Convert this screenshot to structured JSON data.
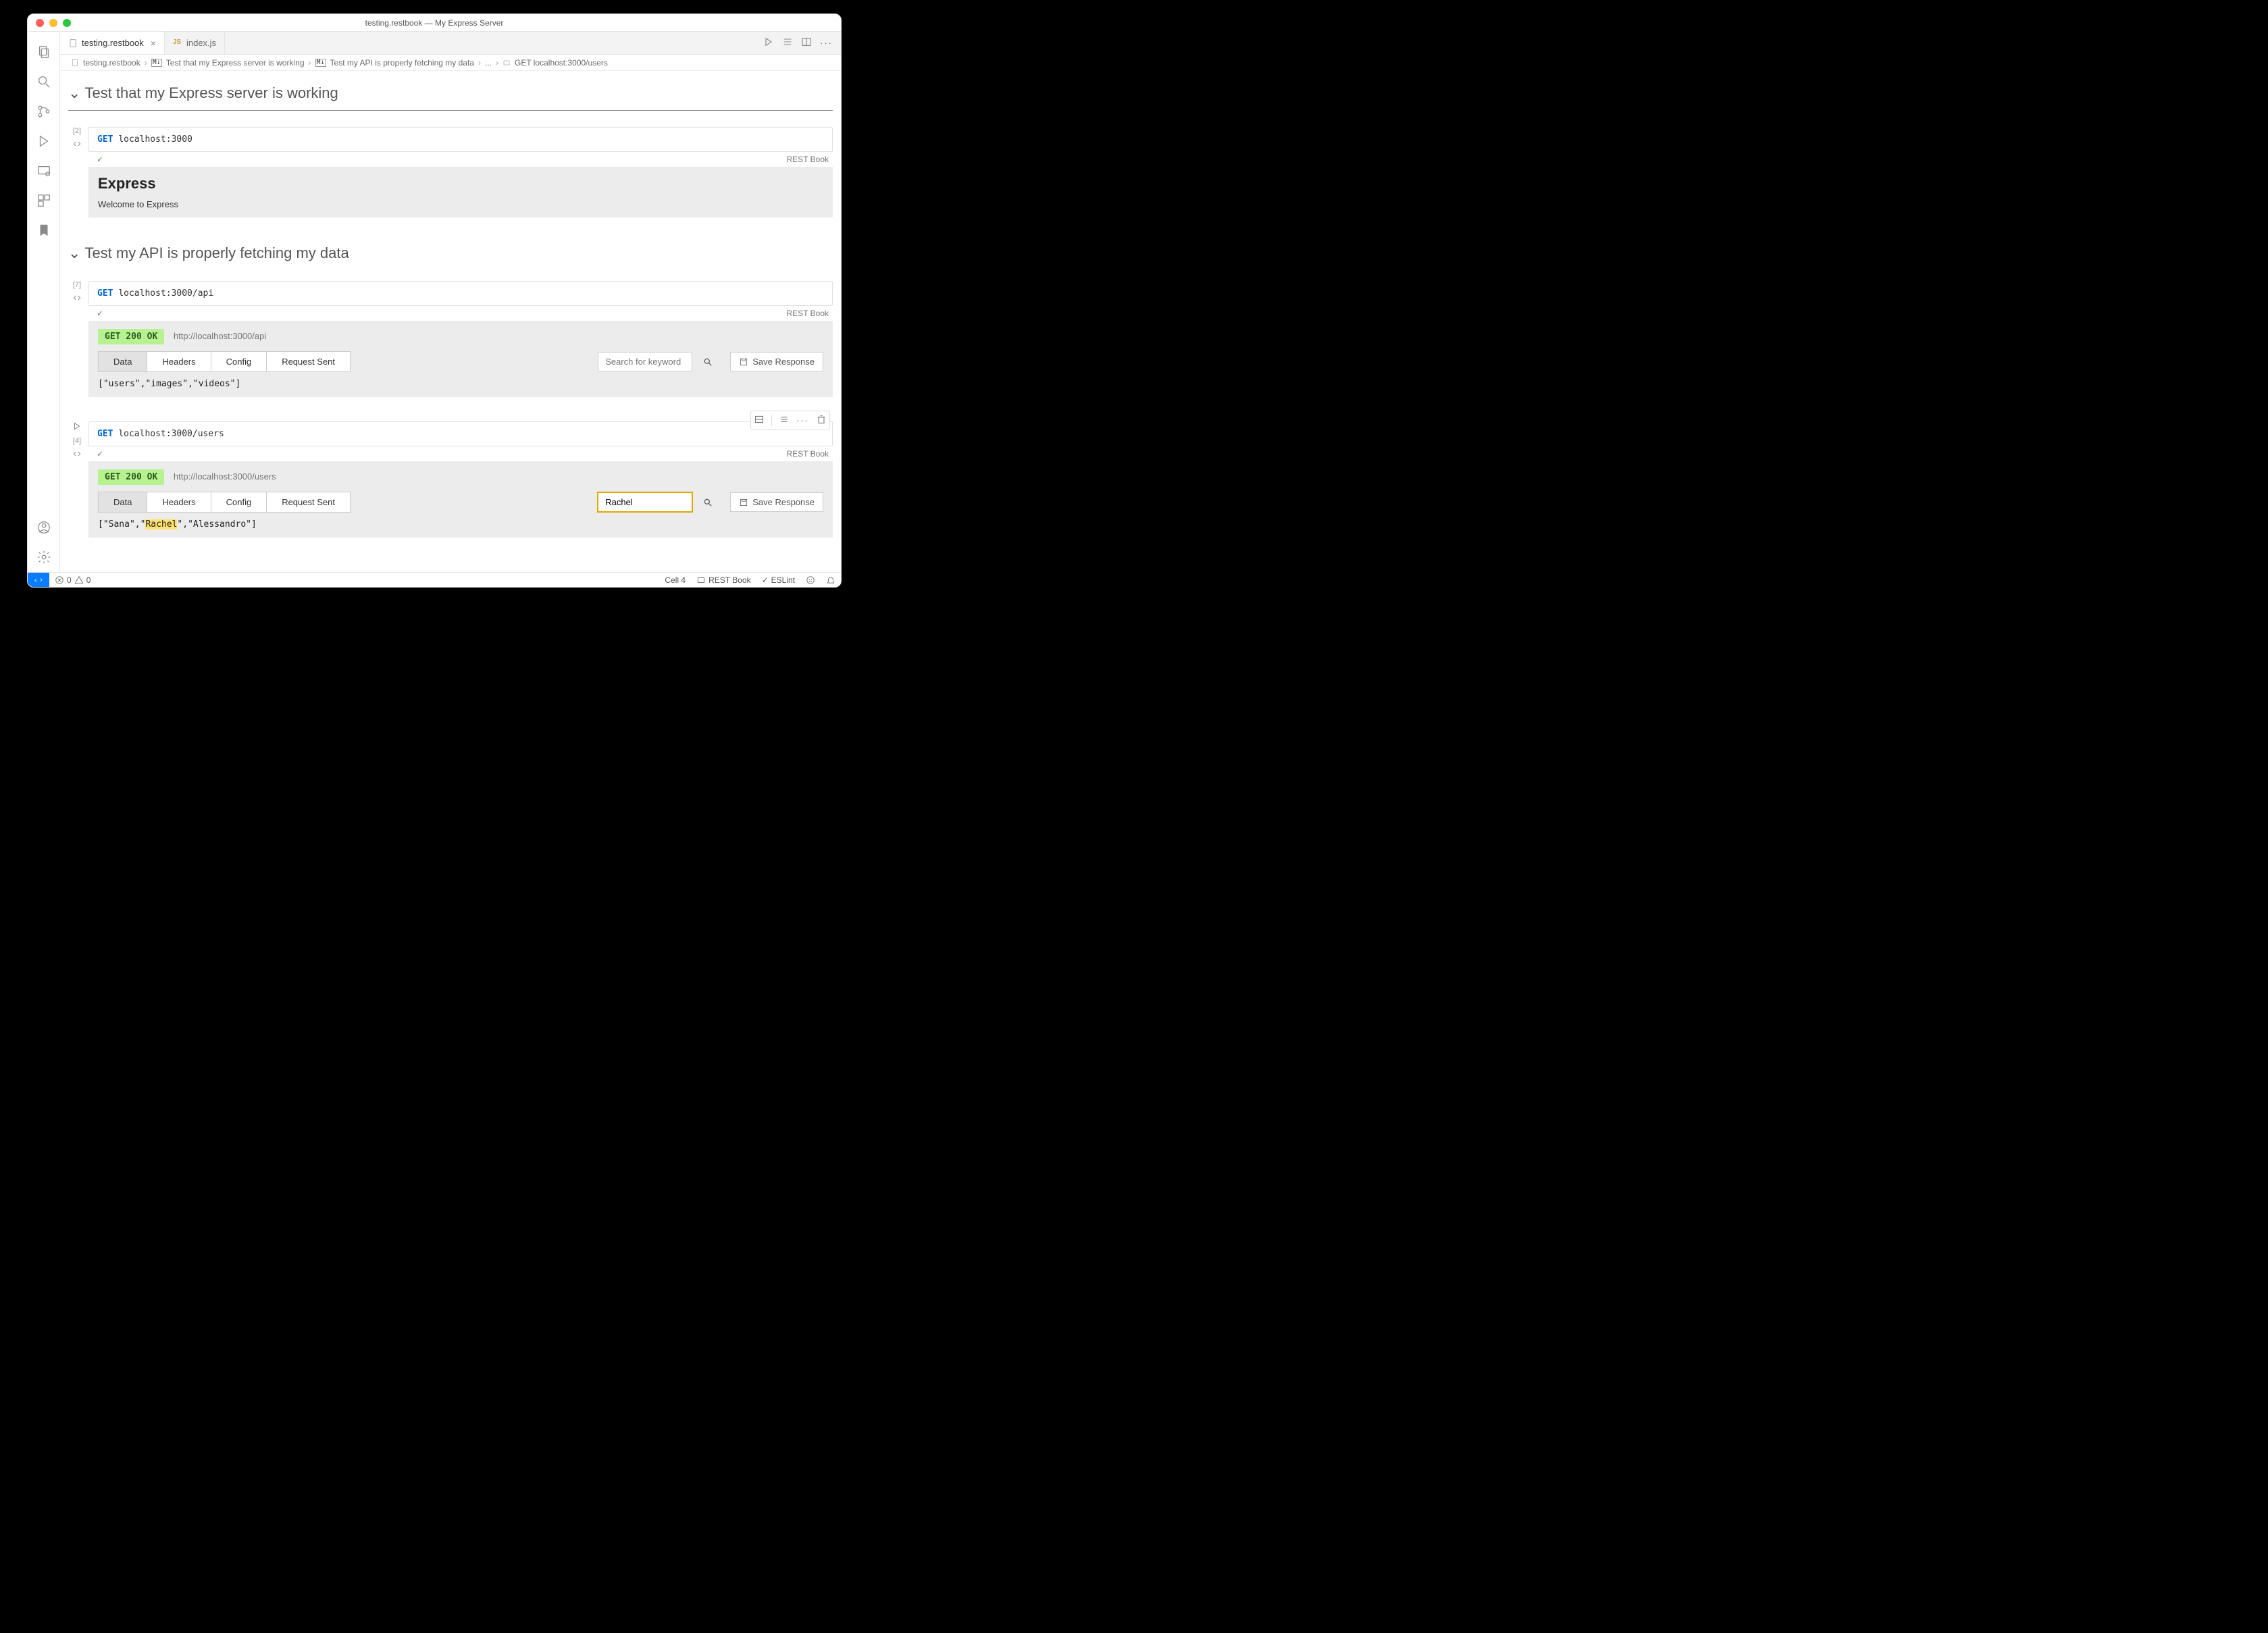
{
  "window": {
    "title": "testing.restbook — My Express Server"
  },
  "tabs": [
    {
      "label": "testing.restbook",
      "active": true,
      "kind": "file"
    },
    {
      "label": "index.js",
      "active": false,
      "kind": "js"
    }
  ],
  "tab_actions": [
    "run-all",
    "clear-outputs",
    "split-editor",
    "more"
  ],
  "breadcrumb": [
    {
      "label": "testing.restbook",
      "icon": "file"
    },
    {
      "label": "Test that my Express server is working",
      "icon": "md"
    },
    {
      "label": "Test my API is properly fetching my data",
      "icon": "md"
    },
    {
      "label": "...",
      "icon": null
    },
    {
      "label": "GET localhost:3000/users",
      "icon": "code-cell"
    }
  ],
  "sections": [
    {
      "title": "Test that my Express server is working"
    },
    {
      "title": "Test my API is properly fetching my data"
    }
  ],
  "cells": [
    {
      "exec_count": "[2]",
      "method": "GET",
      "url": "localhost:3000",
      "lang": "REST Book",
      "output_kind": "html",
      "output_html": {
        "heading": "Express",
        "body": "Welcome to Express"
      }
    },
    {
      "exec_count": "[7]",
      "method": "GET",
      "url": "localhost:3000/api",
      "lang": "REST Book",
      "status_badge": "GET 200 OK",
      "status_url": "http://localhost:3000/api",
      "tabs": [
        "Data",
        "Headers",
        "Config",
        "Request Sent"
      ],
      "active_tab": "Data",
      "search_placeholder": "Search for keyword",
      "search_value": "",
      "save_label": "Save Response",
      "body": "[\"users\",\"images\",\"videos\"]"
    },
    {
      "exec_count": "[4]",
      "method": "GET",
      "url": "localhost:3000/users",
      "lang": "REST Book",
      "status_badge": "GET 200 OK",
      "status_url": "http://localhost:3000/users",
      "tabs": [
        "Data",
        "Headers",
        "Config",
        "Request Sent"
      ],
      "active_tab": "Data",
      "search_placeholder": "",
      "search_value": "Rachel",
      "save_label": "Save Response",
      "body_parts": [
        "[\"Sana\",\"",
        "Rachel",
        "\",\"Alessandro\"]"
      ],
      "show_toolbar": true,
      "show_run": true
    }
  ],
  "statusbar": {
    "errors": "0",
    "warnings": "0",
    "cell": "Cell 4",
    "kernel": "REST Book",
    "eslint": "ESLint"
  }
}
